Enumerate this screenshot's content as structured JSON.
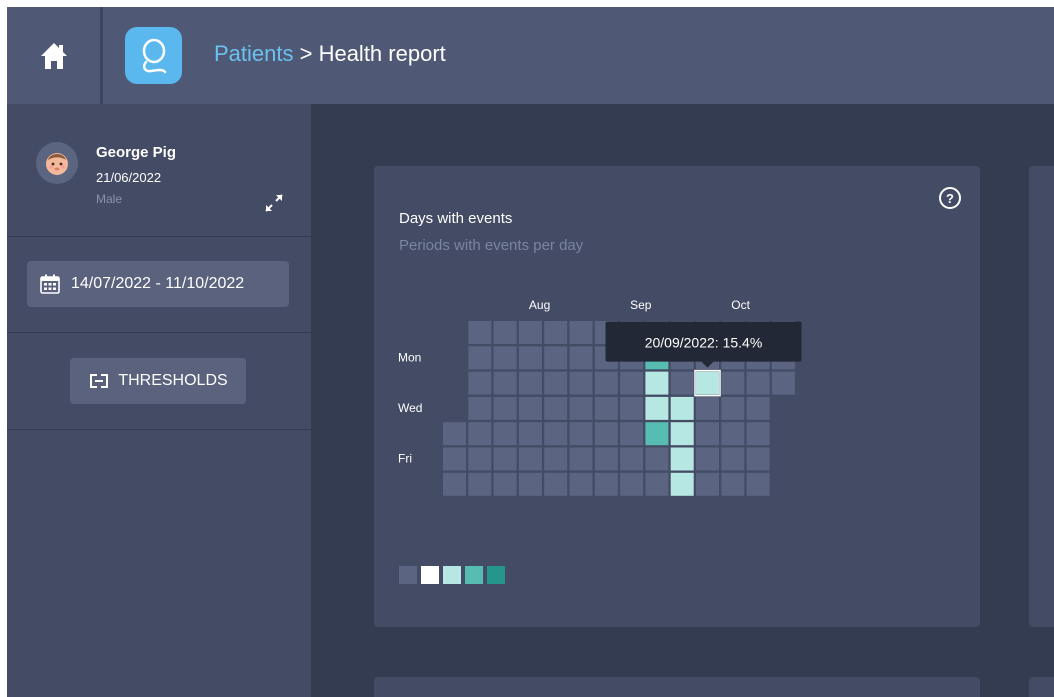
{
  "header": {
    "home_icon": "home-icon",
    "logo_icon": "app-logo-icon",
    "breadcrumb": {
      "link": "Patients",
      "separator": " > ",
      "current": "Health report"
    }
  },
  "patient": {
    "name": "George Pig",
    "dob": "21/06/2022",
    "sex": "Male",
    "expand_icon": "expand-icon"
  },
  "date_range": {
    "label": "14/07/2022 - 11/10/2022",
    "icon": "calendar-icon"
  },
  "thresholds": {
    "label": "THRESHOLDS",
    "icon": "thresholds-icon"
  },
  "card": {
    "title": "Days with events",
    "subtitle": "Periods with events per day",
    "help_icon": "help-icon",
    "help_glyph": "?"
  },
  "chart_data": {
    "type": "heatmap",
    "month_labels": [
      {
        "label": "Aug",
        "week": 3
      },
      {
        "label": "Sep",
        "week": 7
      },
      {
        "label": "Oct",
        "week": 11
      }
    ],
    "day_labels": [
      {
        "label": "Mon",
        "row": 1
      },
      {
        "label": "Wed",
        "row": 3
      },
      {
        "label": "Fri",
        "row": 5
      }
    ],
    "weeks": [
      {
        "start": 4,
        "levels": [
          0,
          0,
          0
        ]
      },
      {
        "start": 0,
        "levels": [
          0,
          0,
          0,
          0,
          0,
          0,
          0
        ]
      },
      {
        "start": 0,
        "levels": [
          0,
          0,
          0,
          0,
          0,
          0,
          0
        ]
      },
      {
        "start": 0,
        "levels": [
          0,
          0,
          0,
          0,
          0,
          0,
          0
        ]
      },
      {
        "start": 0,
        "levels": [
          0,
          0,
          0,
          0,
          0,
          0,
          0
        ]
      },
      {
        "start": 0,
        "levels": [
          0,
          0,
          0,
          0,
          0,
          0,
          0
        ]
      },
      {
        "start": 0,
        "levels": [
          0,
          0,
          0,
          0,
          0,
          0,
          0
        ]
      },
      {
        "start": 0,
        "levels": [
          0,
          0,
          0,
          0,
          0,
          0,
          0
        ]
      },
      {
        "start": 0,
        "levels": [
          0,
          3,
          2,
          2,
          3,
          0,
          0
        ]
      },
      {
        "start": 0,
        "levels": [
          0,
          0,
          0,
          2,
          2,
          2,
          2
        ]
      },
      {
        "start": 0,
        "levels": [
          0,
          0,
          2,
          0,
          0,
          0,
          0
        ]
      },
      {
        "start": 0,
        "levels": [
          0,
          0,
          0,
          0,
          0,
          0,
          0
        ]
      },
      {
        "start": 0,
        "levels": [
          0,
          0,
          0,
          0,
          0,
          0,
          0
        ]
      },
      {
        "start": 0,
        "levels": [
          0,
          0,
          0
        ]
      }
    ],
    "tooltip": {
      "text": "20/09/2022: 15.4%",
      "week": 10,
      "row": 2
    },
    "legend_levels": [
      0,
      1,
      2,
      3,
      4
    ],
    "colors": [
      "#5b6480",
      "#ffffff",
      "#b7e7e2",
      "#57bdb2",
      "#24968a"
    ]
  }
}
